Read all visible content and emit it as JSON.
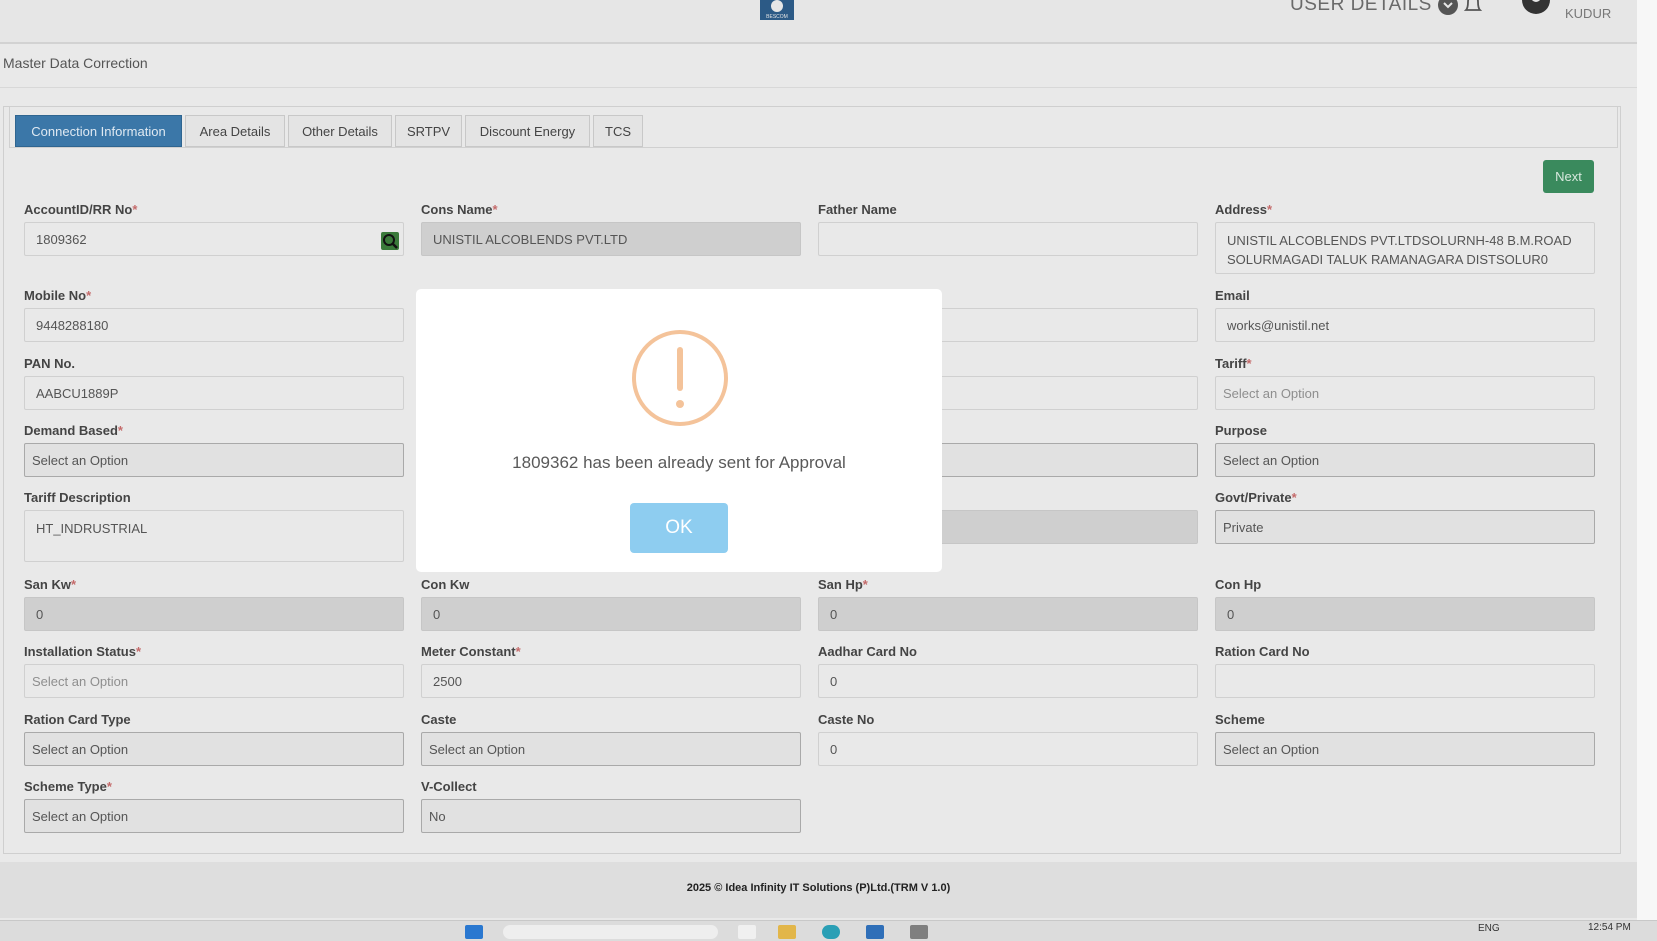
{
  "header": {
    "user_details_label": "USER DETAILS",
    "username": "KUDUR",
    "logo_text": "BESCOM"
  },
  "page": {
    "title": "Master Data Correction"
  },
  "tabs": [
    {
      "label": "Connection Information",
      "active": true
    },
    {
      "label": "Area Details"
    },
    {
      "label": "Other Details"
    },
    {
      "label": "SRTPV"
    },
    {
      "label": "Discount Energy"
    },
    {
      "label": "TCS"
    }
  ],
  "next_label": "Next",
  "fields": {
    "account_id": {
      "label": "AccountID/RR No",
      "required": "*",
      "value": "1809362"
    },
    "cons_name": {
      "label": "Cons Name",
      "required": "*",
      "value": "UNISTIL ALCOBLENDS PVT.LTD"
    },
    "father_name": {
      "label": "Father Name",
      "value": ""
    },
    "address": {
      "label": "Address",
      "required": "*",
      "value": "UNISTIL ALCOBLENDS PVT.LTDSOLURNH-48 B.M.ROAD SOLURMAGADI TALUK RAMANAGARA DISTSOLUR0"
    },
    "mobile": {
      "label": "Mobile No",
      "required": "*",
      "value": "9448288180"
    },
    "email": {
      "label": "Email",
      "value": "works@unistil.net"
    },
    "pan": {
      "label": "PAN No.",
      "value": "AABCU1889P"
    },
    "tariff": {
      "label": "Tariff",
      "required": "*",
      "value": "Select an Option"
    },
    "demand_based": {
      "label": "Demand Based",
      "required": "*",
      "value": "Select an Option"
    },
    "purpose": {
      "label": "Purpose",
      "value": "Select an Option"
    },
    "tariff_desc": {
      "label": "Tariff Description",
      "value": "HT_INDRUSTRIAL"
    },
    "govt_private": {
      "label": "Govt/Private",
      "required": "*",
      "value": "Private"
    },
    "san_kw": {
      "label": "San Kw",
      "required": "*",
      "value": "0"
    },
    "con_kw": {
      "label": "Con Kw",
      "value": "0"
    },
    "san_hp": {
      "label": "San Hp",
      "required": "*",
      "value": "0"
    },
    "con_hp": {
      "label": "Con Hp",
      "value": "0"
    },
    "install_status": {
      "label": "Installation Status",
      "required": "*",
      "value": "Select an Option"
    },
    "meter_constant": {
      "label": "Meter Constant",
      "required": "*",
      "value": "2500"
    },
    "aadhar": {
      "label": "Aadhar Card No",
      "value": "0"
    },
    "ration_no": {
      "label": "Ration Card No",
      "value": ""
    },
    "ration_type": {
      "label": "Ration Card Type",
      "value": "Select an Option"
    },
    "caste": {
      "label": "Caste",
      "value": "Select an Option"
    },
    "caste_no": {
      "label": "Caste No",
      "value": "0"
    },
    "scheme": {
      "label": "Scheme",
      "value": "Select an Option"
    },
    "scheme_type": {
      "label": "Scheme Type",
      "required": "*",
      "value": "Select an Option"
    },
    "v_collect": {
      "label": "V-Collect",
      "value": "No"
    }
  },
  "footer": {
    "text": "2025 © Idea Infinity IT Solutions (P)Ltd.(TRM V 1.0)"
  },
  "taskbar": {
    "lang": "ENG",
    "time": "12:54 PM"
  },
  "modal": {
    "message": "1809362 has been already sent for Approval",
    "ok_label": "OK",
    "icon_color": "#f4c39a"
  },
  "colors": {
    "tab_active": "#3b77a8",
    "next_button": "#3a8a5d",
    "ok_button": "#8ecdf0"
  }
}
